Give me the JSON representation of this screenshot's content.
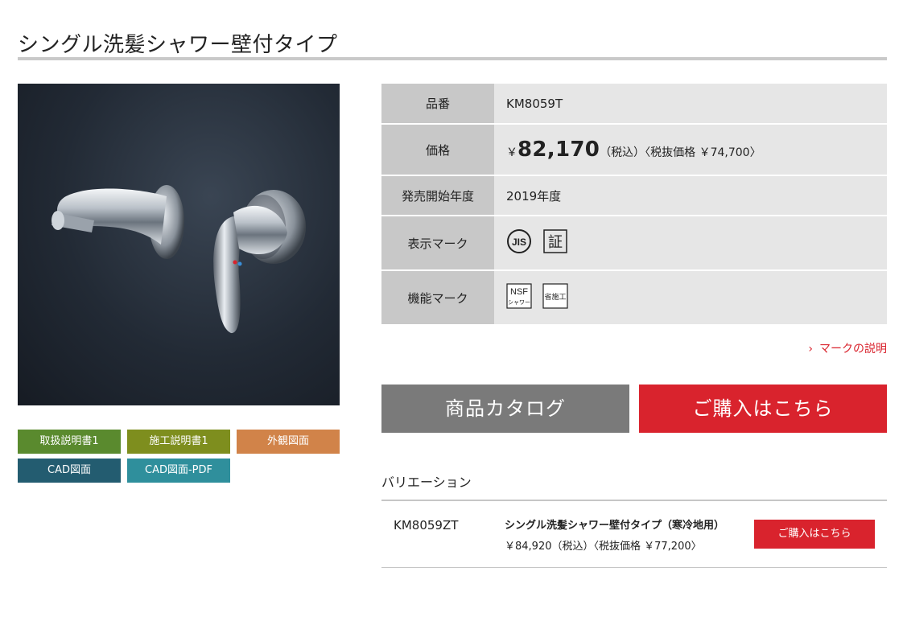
{
  "page": {
    "title": "シングル洗髪シャワー壁付タイプ"
  },
  "docs": [
    {
      "label": "取扱説明書1",
      "color": "#5a8a2e"
    },
    {
      "label": "施工説明書1",
      "color": "#7e8e1e"
    },
    {
      "label": "外観図面",
      "color": "#d18349"
    },
    {
      "label": "CAD図面",
      "color": "#235c70"
    },
    {
      "label": "CAD図面-PDF",
      "color": "#2f8f9c"
    }
  ],
  "spec": {
    "part_number_label": "品番",
    "part_number": "KM8059T",
    "price_label": "価格",
    "price_yen": "￥",
    "price_value": "82,170",
    "price_tax_note": "（税込）〈税抜価格 ￥74,700〉",
    "release_label": "発売開始年度",
    "release_value": "2019年度",
    "display_mark_label": "表示マーク",
    "display_marks": [
      "JIS",
      "証"
    ],
    "function_mark_label": "機能マーク",
    "function_marks": [
      {
        "line1": "NSF",
        "line2": "シャワー"
      },
      {
        "line1": "省施工"
      }
    ]
  },
  "mark_link": "マークの説明",
  "buttons": {
    "catalog": "商品カタログ",
    "buy": "ご購入はこちら"
  },
  "colors": {
    "accent_red": "#d9232d",
    "catalog_gray": "#7a7a7a"
  },
  "variation": {
    "heading": "バリエーション",
    "items": [
      {
        "code": "KM8059ZT",
        "name": "シングル洗髪シャワー壁付タイプ（寒冷地用）",
        "price": "￥84,920（税込）〈税抜価格 ￥77,200〉",
        "buy_label": "ご購入はこちら"
      }
    ]
  }
}
